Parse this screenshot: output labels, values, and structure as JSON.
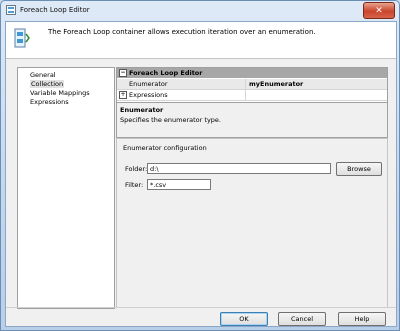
{
  "window": {
    "title": "Foreach Loop Editor",
    "close_glyph": "✕"
  },
  "header": {
    "description": "The Foreach Loop container allows execution iteration over an enumeration."
  },
  "nav": {
    "items": [
      "General",
      "Collection",
      "Variable Mappings",
      "Expressions"
    ],
    "selected": "Collection"
  },
  "grid": {
    "category": "Foreach Loop Editor",
    "rows": [
      {
        "name": "Enumerator",
        "value": "myEnumerator",
        "expander": ""
      },
      {
        "name": "Expressions",
        "value": "",
        "expander": "+"
      }
    ]
  },
  "description_panel": {
    "title": "Enumerator",
    "text": "Specifies the enumerator type."
  },
  "config": {
    "title": "Enumerator configuration",
    "folder_label": "Folder:",
    "folder_value": "d:\\",
    "browse_label": "Browse",
    "filter_label": "Filter:",
    "filter_value": "*.csv"
  },
  "footer": {
    "ok_label": "OK",
    "cancel_label": "Cancel",
    "help_label": "Help"
  },
  "icons": {
    "title": "foreach-loop-icon",
    "header": "foreach-container-icon",
    "close": "close-icon"
  }
}
